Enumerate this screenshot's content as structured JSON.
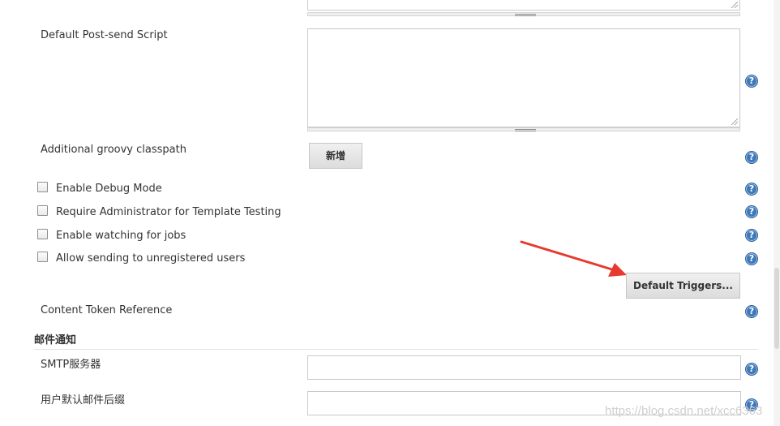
{
  "form": {
    "post_send_script": {
      "label": "Default Post-send Script",
      "value": ""
    },
    "groovy_classpath": {
      "label": "Additional groovy classpath",
      "add_button": "新增"
    },
    "checkboxes": [
      {
        "label": "Enable Debug Mode",
        "checked": false
      },
      {
        "label": "Require Administrator for Template Testing",
        "checked": false
      },
      {
        "label": "Enable watching for jobs",
        "checked": false
      },
      {
        "label": "Allow sending to unregistered users",
        "checked": false
      }
    ],
    "default_triggers_button": "Default Triggers...",
    "content_token_reference": {
      "label": "Content Token Reference"
    }
  },
  "mail_section": {
    "title": "邮件通知",
    "smtp_server": {
      "label": "SMTP服务器",
      "value": ""
    },
    "default_user_suffix": {
      "label": "用户默认邮件后缀",
      "value": ""
    }
  },
  "help_icon_glyph": "?",
  "annotation": {
    "arrow_color": "#e8392f"
  },
  "watermark": "https://blog.csdn.net/xcc6363"
}
